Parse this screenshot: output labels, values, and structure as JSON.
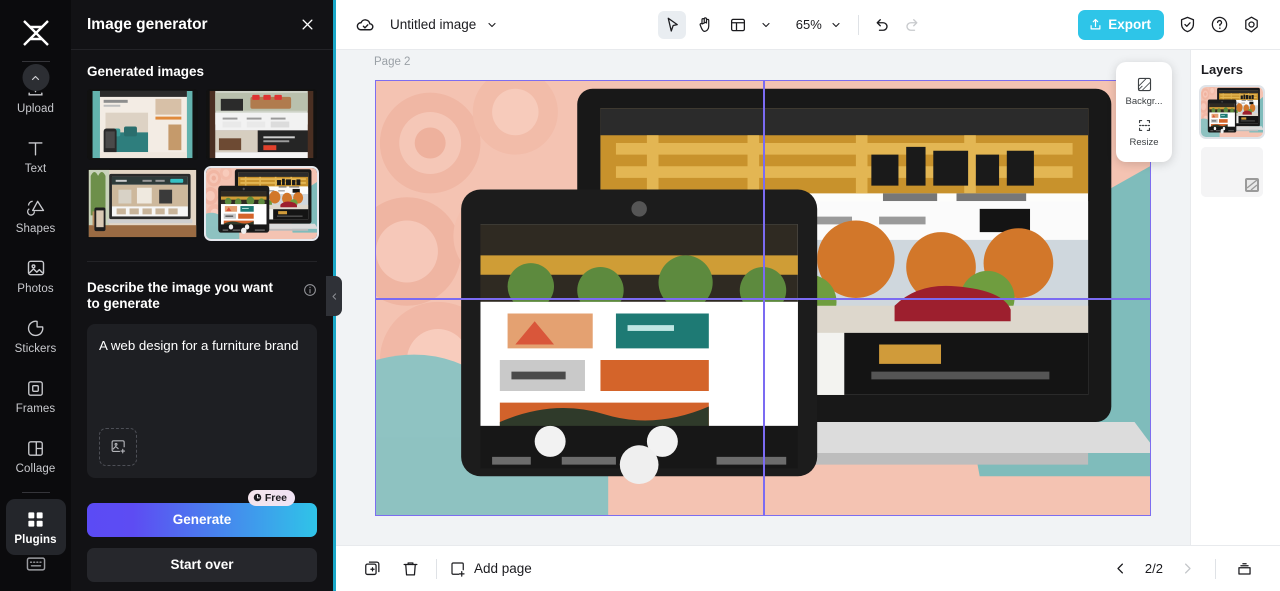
{
  "app": {
    "brand_icon": "capcut-logo-icon",
    "accent_cyan": "#2ec5e8",
    "panel_bg": "#121215",
    "guide_color": "#7b6bf2"
  },
  "rail": {
    "items": [
      {
        "label": "Upload",
        "icon": "upload-icon",
        "active": false
      },
      {
        "label": "Text",
        "icon": "text-icon",
        "active": false
      },
      {
        "label": "Shapes",
        "icon": "shapes-icon",
        "active": false
      },
      {
        "label": "Photos",
        "icon": "photos-icon",
        "active": false
      },
      {
        "label": "Stickers",
        "icon": "stickers-icon",
        "active": false
      },
      {
        "label": "Frames",
        "icon": "frames-icon",
        "active": false
      },
      {
        "label": "Collage",
        "icon": "collage-icon",
        "active": false
      },
      {
        "label": "Plugins",
        "icon": "plugins-icon",
        "active": true
      }
    ],
    "scroll_up_icon": "chevron-up-icon",
    "bottom_icon": "keyboard-icon"
  },
  "panel": {
    "title": "Image generator",
    "close_icon": "close-icon",
    "generated_section_title": "Generated images",
    "thumbnails": [
      {
        "name": "generated-image-1",
        "selected": false
      },
      {
        "name": "generated-image-2",
        "selected": false
      },
      {
        "name": "generated-image-3",
        "selected": false
      },
      {
        "name": "generated-image-4",
        "selected": true
      }
    ],
    "prompt_label": "Describe the image you want to generate",
    "info_icon": "info-icon",
    "prompt_value": "A web design for a furniture brand",
    "prompt_placeholder": "Describe the image you want to generate",
    "upload_image_icon": "add-image-icon",
    "generate_label": "Generate",
    "free_badge": "Free",
    "free_badge_icon": "clock-icon",
    "start_over_label": "Start over",
    "collapse_icon": "chevron-left-icon"
  },
  "topbar": {
    "cloud_icon": "cloud-saved-icon",
    "doc_title": "Untitled image",
    "title_chevron_icon": "chevron-down-icon",
    "tools": [
      {
        "name": "select-tool",
        "icon": "cursor-icon",
        "selected": true
      },
      {
        "name": "hand-tool",
        "icon": "hand-icon",
        "selected": false
      },
      {
        "name": "layout-tool",
        "icon": "layout-icon",
        "selected": false
      }
    ],
    "layout_chevron_icon": "chevron-down-icon",
    "zoom_value": "65%",
    "zoom_chevron_icon": "chevron-down-icon",
    "undo_icon": "undo-icon",
    "redo_icon": "redo-icon",
    "export_label": "Export",
    "export_icon": "share-icon",
    "shield_icon": "shield-check-icon",
    "help_icon": "question-circle-icon",
    "settings_icon": "gear-icon"
  },
  "canvas": {
    "page_label": "Page 2",
    "context_menu": [
      {
        "label": "Backgr...",
        "icon": "background-icon",
        "name": "background-menu-item"
      },
      {
        "label": "Resize",
        "icon": "resize-icon",
        "name": "resize-menu-item"
      }
    ]
  },
  "layers": {
    "title": "Layers",
    "items": [
      {
        "name": "layer-image",
        "type": "image",
        "selected": true
      },
      {
        "name": "layer-background",
        "type": "background",
        "selected": false
      }
    ]
  },
  "bottombar": {
    "duplicate_icon": "duplicate-page-icon",
    "delete_icon": "delete-page-icon",
    "add_page_label": "Add page",
    "add_page_icon": "add-page-icon",
    "prev_icon": "chevron-left-icon",
    "page_indicator": "2/2",
    "next_icon": "chevron-right-icon",
    "grid_icon": "pages-grid-icon"
  }
}
